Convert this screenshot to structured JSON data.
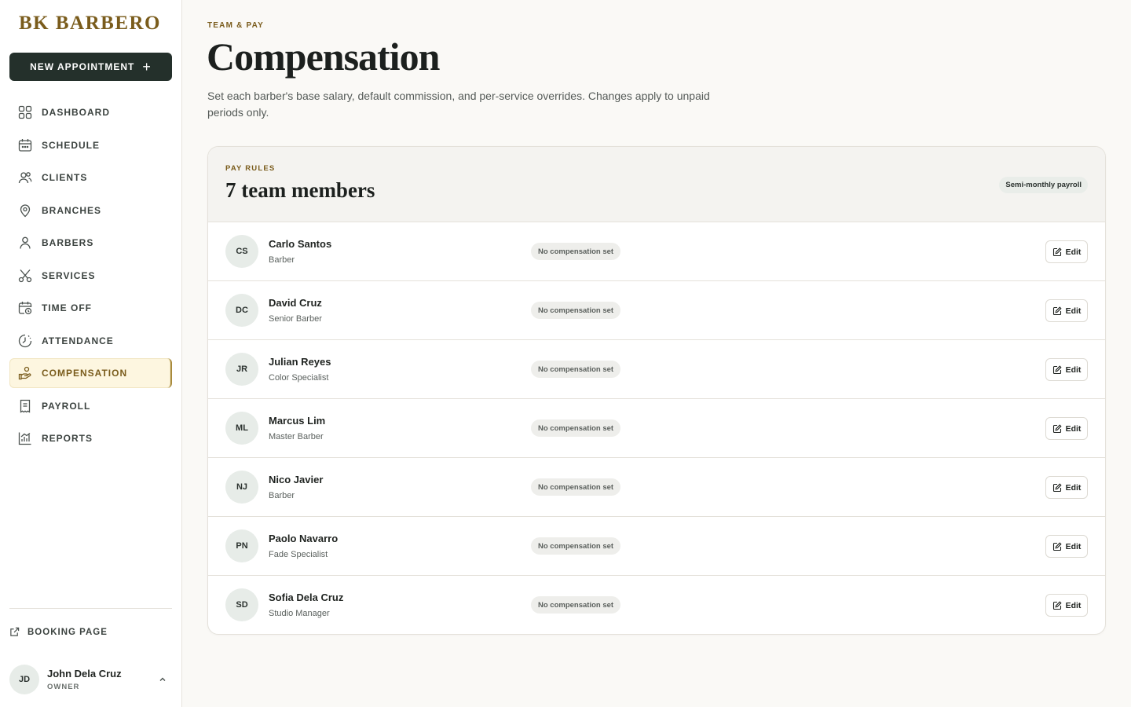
{
  "sidebar": {
    "brand": "BK BARBERO",
    "new_appointment": "NEW APPOINTMENT",
    "items": [
      {
        "label": "DASHBOARD",
        "icon": "grid-icon"
      },
      {
        "label": "SCHEDULE",
        "icon": "calendar-icon"
      },
      {
        "label": "CLIENTS",
        "icon": "users-icon"
      },
      {
        "label": "BRANCHES",
        "icon": "map-pin-icon"
      },
      {
        "label": "BARBERS",
        "icon": "user-icon"
      },
      {
        "label": "SERVICES",
        "icon": "scissors-icon"
      },
      {
        "label": "TIME OFF",
        "icon": "calendar-clock-icon"
      },
      {
        "label": "ATTENDANCE",
        "icon": "clock-icon"
      },
      {
        "label": "COMPENSATION",
        "icon": "hand-coins-icon",
        "active": true
      },
      {
        "label": "PAYROLL",
        "icon": "receipt-icon"
      },
      {
        "label": "REPORTS",
        "icon": "bar-chart-icon"
      }
    ],
    "booking_page": "BOOKING PAGE",
    "user": {
      "initials": "JD",
      "name": "John Dela Cruz",
      "role": "OWNER"
    }
  },
  "header": {
    "eyebrow": "TEAM & PAY",
    "title": "Compensation",
    "subtitle": "Set each barber's base salary, default commission, and per-service overrides. Changes apply to unpaid periods only."
  },
  "card": {
    "eyebrow": "PAY RULES",
    "title": "7 team members",
    "badge": "Semi-monthly payroll",
    "edit_label": "Edit",
    "members": [
      {
        "initials": "CS",
        "name": "Carlo Santos",
        "role": "Barber",
        "status": "No compensation set"
      },
      {
        "initials": "DC",
        "name": "David Cruz",
        "role": "Senior Barber",
        "status": "No compensation set"
      },
      {
        "initials": "JR",
        "name": "Julian Reyes",
        "role": "Color Specialist",
        "status": "No compensation set"
      },
      {
        "initials": "ML",
        "name": "Marcus Lim",
        "role": "Master Barber",
        "status": "No compensation set"
      },
      {
        "initials": "NJ",
        "name": "Nico Javier",
        "role": "Barber",
        "status": "No compensation set"
      },
      {
        "initials": "PN",
        "name": "Paolo Navarro",
        "role": "Fade Specialist",
        "status": "No compensation set"
      },
      {
        "initials": "SD",
        "name": "Sofia Dela Cruz",
        "role": "Studio Manager",
        "status": "No compensation set"
      }
    ]
  },
  "colors": {
    "accent": "#7a5c1c",
    "primary_button": "#24302b",
    "active_nav_bg": "#fdf6e0"
  }
}
